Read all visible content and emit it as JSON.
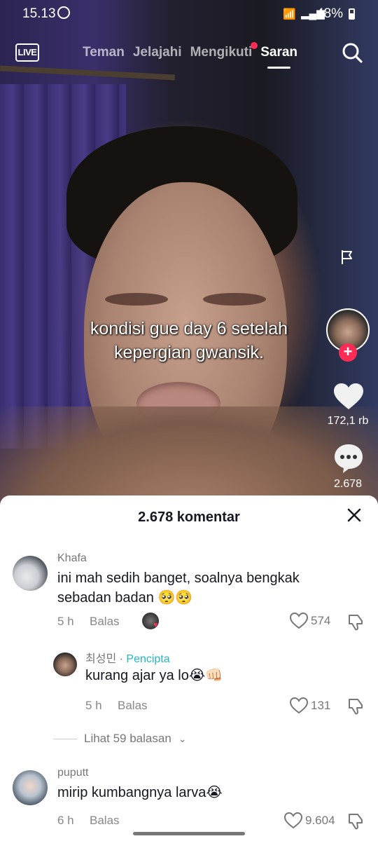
{
  "status": {
    "time": "15.13",
    "battery": "48%"
  },
  "topnav": {
    "live": "LIVE",
    "tabs": [
      "Teman",
      "Jelajahi",
      "Mengikuti",
      "Saran"
    ],
    "active_tab": "Saran"
  },
  "video": {
    "caption_line1": "kondisi gue day 6 setelah",
    "caption_line2": "kepergian gwansik."
  },
  "actions": {
    "likes": "172,1 rb",
    "comments": "2.678"
  },
  "sheet": {
    "title": "2.678 komentar",
    "comments": [
      {
        "user": "Khafa",
        "text_line1": "ini mah sedih banget, soalnya bengkak",
        "text_line2": "sebadan badan 🥺🥺",
        "time": "5 h",
        "reply": "Balas",
        "likes": "574"
      },
      {
        "user": "최성민",
        "creator": "Pencipta",
        "sep": " · ",
        "text": "kurang ajar ya lo😭👊🏻",
        "time": "5 h",
        "reply": "Balas",
        "likes": "131"
      },
      {
        "user": "puputt",
        "text": "mirip kumbangnya larva😭",
        "time": "6 h",
        "reply": "Balas",
        "likes": "9.604"
      }
    ],
    "view_replies": "Lihat 59 balasan"
  },
  "colors": {
    "accent": "#fe2c55",
    "creator": "#20b8c4"
  }
}
